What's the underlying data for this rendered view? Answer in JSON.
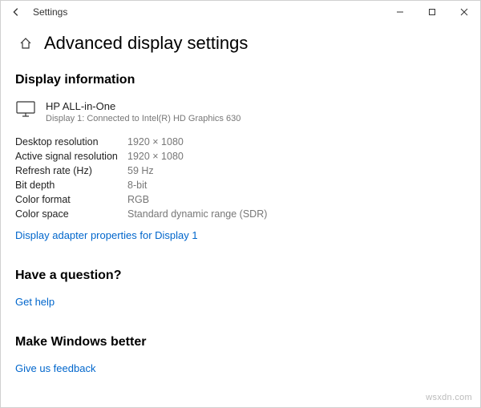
{
  "titlebar": {
    "app_name": "Settings"
  },
  "header": {
    "title": "Advanced display settings"
  },
  "display_info": {
    "section_title": "Display information",
    "monitor_name": "HP ALL-in-One",
    "monitor_sub": "Display 1: Connected to Intel(R) HD Graphics 630",
    "specs": {
      "desktop_resolution_label": "Desktop resolution",
      "desktop_resolution_value": "1920 × 1080",
      "active_resolution_label": "Active signal resolution",
      "active_resolution_value": "1920 × 1080",
      "refresh_label": "Refresh rate (Hz)",
      "refresh_value": "59 Hz",
      "bitdepth_label": "Bit depth",
      "bitdepth_value": "8-bit",
      "colorformat_label": "Color format",
      "colorformat_value": "RGB",
      "colorspace_label": "Color space",
      "colorspace_value": "Standard dynamic range (SDR)"
    },
    "adapter_link": "Display adapter properties for Display 1"
  },
  "help": {
    "title": "Have a question?",
    "link": "Get help"
  },
  "feedback": {
    "title": "Make Windows better",
    "link": "Give us feedback"
  },
  "watermark": "wsxdn.com"
}
